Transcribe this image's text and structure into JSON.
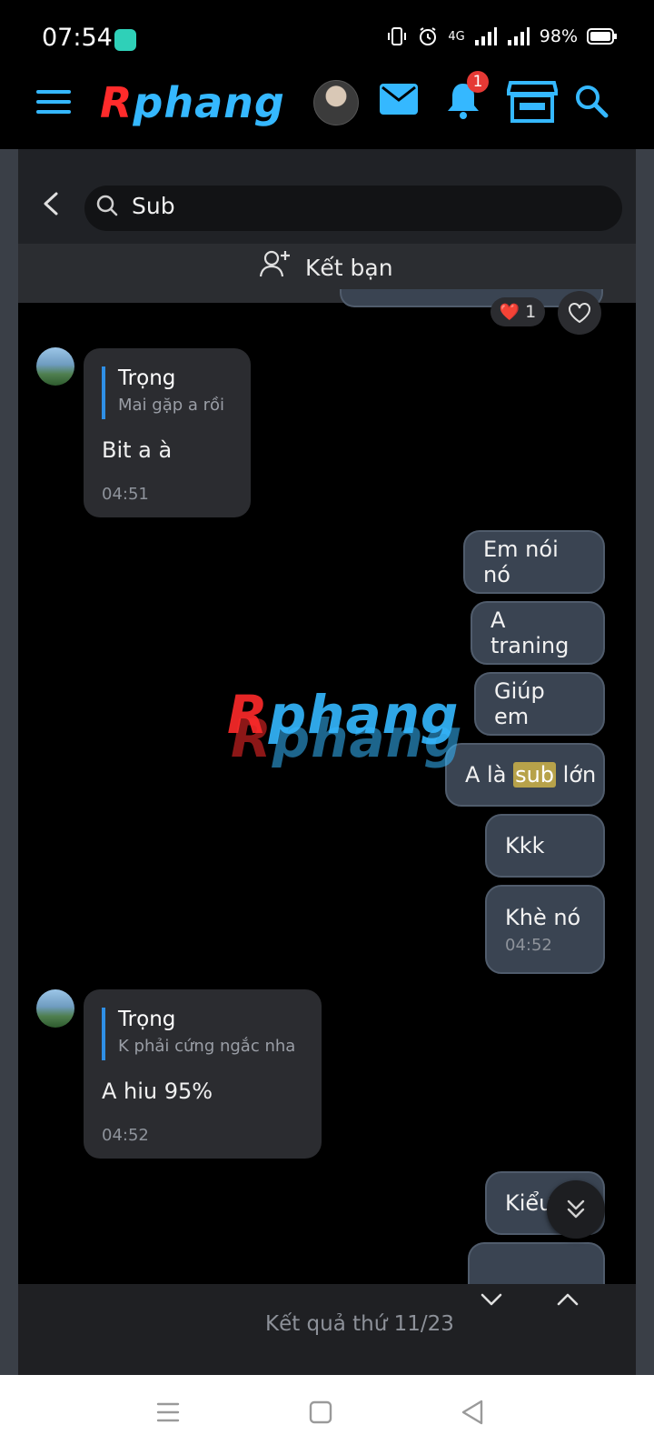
{
  "status_bar": {
    "time": "07:54",
    "network": "4G",
    "battery": "98%"
  },
  "header": {
    "logo": {
      "first": "R",
      "rest": "phang"
    },
    "notification_count": "1",
    "icons": [
      "menu-icon",
      "avatar",
      "mail-icon",
      "bell-icon",
      "store-icon",
      "search-icon"
    ]
  },
  "search": {
    "query": "Sub",
    "add_friend_label": "Kết bạn"
  },
  "reaction": {
    "emoji": "❤️",
    "count": "1"
  },
  "watermark": "Rphang",
  "messages_in": [
    {
      "quote_name": "Trọng",
      "quote_text": "Mai gặp a rồi",
      "text": "Bit a à",
      "time": "04:51"
    },
    {
      "quote_name": "Trọng",
      "quote_text": "K phải cứng ngắc nha",
      "text": "A hiu 95%",
      "time": "04:52"
    }
  ],
  "messages_out": [
    {
      "text": "Em nói nó"
    },
    {
      "text": "A traning"
    },
    {
      "text": "Giúp em"
    },
    {
      "before": "A là ",
      "highlight": "sub",
      "after": " lớn"
    },
    {
      "text": "Kkk"
    },
    {
      "text": "Khè nó",
      "time": "04:52"
    },
    {
      "text": "Kiểu"
    }
  ],
  "result_bar": {
    "label": "Kết quả thứ 11/23"
  },
  "colors": {
    "accent": "#35b8ff",
    "brand_red": "#ff2b2b",
    "badge": "#e53935",
    "highlight": "#b7a24a"
  }
}
